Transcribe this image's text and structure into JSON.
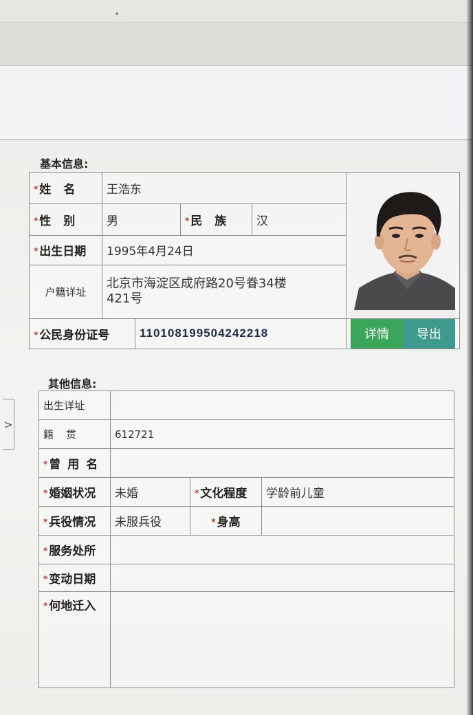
{
  "basic_info": {
    "section_title": "基本信息:",
    "name_label": "姓名",
    "name_value": "王浩东",
    "gender_label": "性别",
    "gender_value": "男",
    "ethnicity_label": "民族",
    "ethnicity_value": "汉",
    "birthdate_label": "出生日期",
    "birthdate_value": "1995年4月24日",
    "household_label": "户籍详址",
    "household_value_line1": "北京市海淀区成府路20号眷34楼",
    "household_value_line2": "421号",
    "id_label": "公民身份证号",
    "id_value": "110108199504242218",
    "details_button": "详情",
    "export_button": "导出"
  },
  "other_info": {
    "section_title": "其他信息:",
    "birthplace_label": "出生详址",
    "birthplace_value": "",
    "native_place_label": "籍贯",
    "native_place_value": "612721",
    "former_name_label": "曾用名",
    "former_name_value": "",
    "marital_label": "婚姻状况",
    "marital_value": "未婚",
    "education_label": "文化程度",
    "education_value": "学龄前儿童",
    "military_label": "兵役情况",
    "military_value": "未服兵役",
    "height_label": "身高",
    "height_value": "",
    "service_place_label": "服务处所",
    "service_place_value": "",
    "change_date_label": "变动日期",
    "change_date_value": "",
    "moved_from_label": "何地迁入",
    "moved_from_value": ""
  },
  "side_tab": {
    "arrow": ">"
  },
  "colors": {
    "details_button": "#3aa65a",
    "export_button": "#3e9a8d",
    "required_mark": "#c0392b",
    "id_text": "#1f2d4a"
  },
  "icons": {
    "required": "asterisk",
    "side_tab": "chevron-right-icon"
  }
}
